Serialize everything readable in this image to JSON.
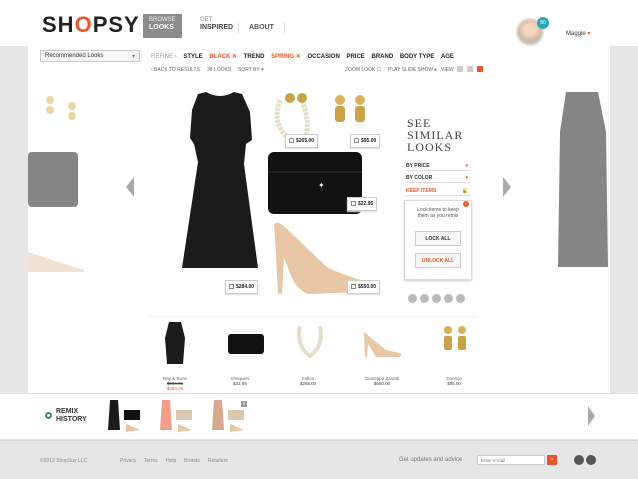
{
  "brand": {
    "logo_pre": "SH",
    "logo_o": "O",
    "logo_post": "PSY"
  },
  "nav": [
    {
      "top": "BROWSE",
      "bottom": "LOOKS"
    },
    {
      "top": "GET",
      "bottom": "INSPIRED"
    },
    {
      "label": "ABOUT"
    }
  ],
  "user": {
    "name": "Maggie",
    "badge": "80",
    "caret": "▾"
  },
  "toolbar": {
    "dropdown": "Recommended Looks",
    "refine_label": "REFINE ›",
    "filters": [
      "STYLE",
      "BLACK ✕",
      "TREND",
      "SPRING ✕",
      "OCCASION",
      "PRICE",
      "BRAND",
      "BODY TYPE",
      "AGE"
    ],
    "back": "‹ BACK TO RESULTS",
    "count": "38 LOOKS",
    "sort": "SORT BY ▾",
    "zoom": "ZOOM LOOK ☐",
    "slideshow": "PLAY SLIDE SHOW ▸",
    "view": "VIEW"
  },
  "look": {
    "prices": {
      "earrings": "$95.00",
      "necklace": "$265.00",
      "clutch": "$22.95",
      "dress": "$284.00",
      "shoes": "$550.00"
    }
  },
  "panel": {
    "see": [
      "SEE",
      "SIMILAR",
      "LOOKS"
    ],
    "by_price": "BY PRICE",
    "by_color": "BY COLOR",
    "keep": "KEEP ITEMS",
    "lock_msg": "Lock items to keep them as you remix",
    "lock_all": "LOCK ALL",
    "unlock_all": "UNLOCK ALL",
    "close": "×"
  },
  "items": [
    {
      "brand": "Ray & Bone",
      "price": "$566.31",
      "sale": "$284.00"
    },
    {
      "brand": "Shequeni",
      "price": "$22.95"
    },
    {
      "brand": "Fallon",
      "price": "$265.00"
    },
    {
      "brand": "Giuseppe Zanotti",
      "price": "$550.00"
    },
    {
      "brand": "Dannijo",
      "price": "$95.00"
    }
  ],
  "remix": {
    "line1": "REMIX",
    "line2": "HISTORY",
    "count": "5"
  },
  "footer": {
    "copy": "©2012 ShopSuy LLC",
    "links": [
      "Privacy",
      "Terms",
      "Help",
      "Brands",
      "Retailers"
    ],
    "updates": "Get updates and advice",
    "email_placeholder": "Enter e-mail",
    "go": "›"
  },
  "colors": {
    "accent": "#e8572a",
    "teal": "#2aa5b8",
    "green": "#3a8a5a"
  }
}
